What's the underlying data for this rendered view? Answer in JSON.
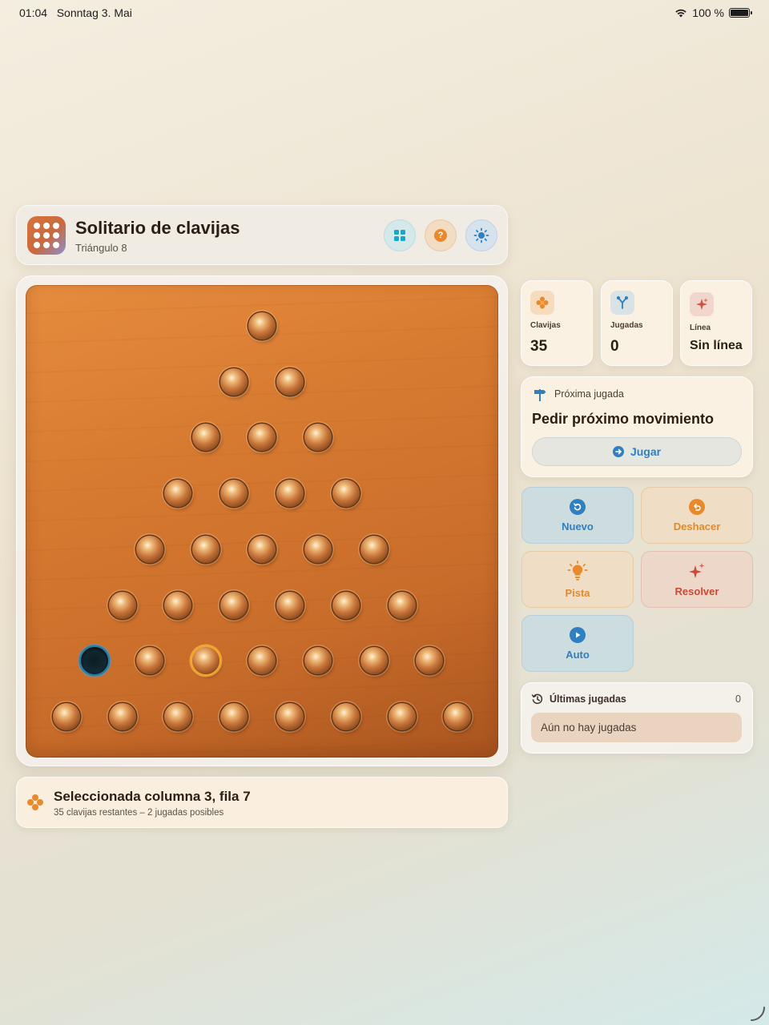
{
  "status_bar": {
    "time": "01:04",
    "date": "Sonntag 3. Mai",
    "battery": "100 %",
    "battery_level": 1.0
  },
  "header": {
    "title": "Solitario de clavijas",
    "subtitle": "Triángulo 8",
    "buttons": [
      "grid-icon",
      "help-icon",
      "sun-icon"
    ],
    "accent": "#e8892c"
  },
  "board": {
    "rows": 8,
    "empty_hole": {
      "row": 7,
      "col": 1
    },
    "selected_peg": {
      "row": 7,
      "col": 3
    },
    "peg_color": "#c8753a",
    "wood_color": "#d77a31"
  },
  "selection": {
    "title": "Seleccionada columna 3, fila 7",
    "subtitle": "35 clavijas restantes – 2 jugadas posibles"
  },
  "stats": {
    "pegs": {
      "label": "Clavijas",
      "value": "35"
    },
    "moves": {
      "label": "Jugadas",
      "value": "0"
    },
    "line": {
      "label": "Línea",
      "value": "Sin línea"
    }
  },
  "next_move": {
    "label": "Próxima jugada",
    "title": "Pedir próximo movimiento",
    "button": "Jugar"
  },
  "actions": {
    "new": "Nuevo",
    "undo": "Deshacer",
    "hint": "Pista",
    "solve": "Resolver",
    "auto": "Auto"
  },
  "history": {
    "title": "Últimas jugadas",
    "count": "0",
    "empty": "Aún no hay jugadas"
  }
}
